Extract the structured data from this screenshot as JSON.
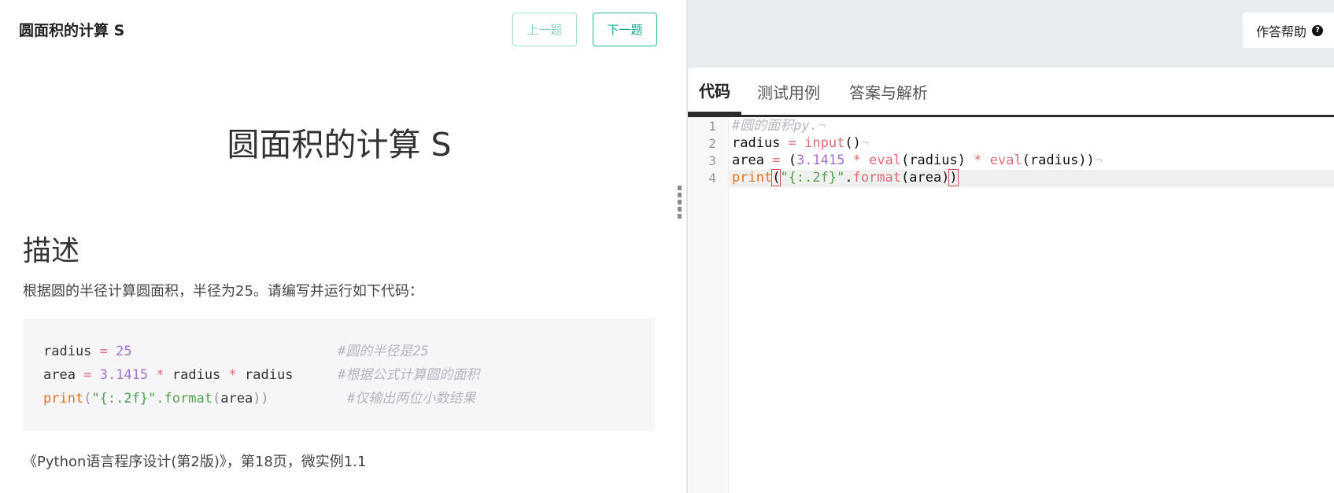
{
  "left": {
    "header_title": "圆面积的计算 S",
    "prev_label": "上一题",
    "next_label": "下一题",
    "problem_title": "圆面积的计算 S",
    "description_heading": "描述",
    "description_text": "根据圆的半径计算圆面积，半径为25。请编写并运行如下代码：",
    "example": {
      "line1": {
        "a": "radius",
        "op": "=",
        "num": "25",
        "comment": "#圆的半径是25"
      },
      "line2": {
        "a": "area",
        "op": "=",
        "num": "3.1415",
        "mul1": "*",
        "b": "radius",
        "mul2": "*",
        "c": "radius",
        "comment": "#根据公式计算圆的面积"
      },
      "line3": {
        "kw": "print",
        "lp": "(",
        "str": "\"{:.2f}\"",
        "method": ".format",
        "lp2": "(",
        "arg": "area",
        "rp": "))",
        "comment": "#仅输出两位小数结果"
      }
    },
    "source_text": "《Python语言程序设计(第2版)》，第18页，微实例1.1"
  },
  "right": {
    "help_label": "作答帮助",
    "help_icon": "question-circle-icon",
    "tabs": [
      {
        "label": "代码",
        "active": true
      },
      {
        "label": "测试用例",
        "active": false
      },
      {
        "label": "答案与解析",
        "active": false
      }
    ],
    "editor": {
      "line_numbers": [
        "1",
        "2",
        "3",
        "4"
      ],
      "line1": {
        "comment": "#圆的面积py."
      },
      "line2": {
        "a": "radius",
        "op": "=",
        "fn": "input",
        "paren": "()"
      },
      "line3": {
        "a": "area",
        "op": "=",
        "lp": "(",
        "num": "3.1415",
        "mul1": "*",
        "fn1": "eval",
        "arg1": "(radius)",
        "mul2": "*",
        "fn2": "eval",
        "arg2": "(radius))"
      },
      "line4": {
        "kw": "print",
        "lp": "(",
        "str": "\"{:.2f}\"",
        "dot": ".",
        "method": "format",
        "arg": "(area)",
        "rp": ")"
      },
      "eol_marker": "¬"
    }
  },
  "colors": {
    "accent": "#1aa595",
    "accent_light": "#8fd0c8",
    "comment": "#b5b5bd",
    "keyword": "#e0731c",
    "string": "#50a14f",
    "number": "#a572c9",
    "operator": "#e06c75"
  }
}
